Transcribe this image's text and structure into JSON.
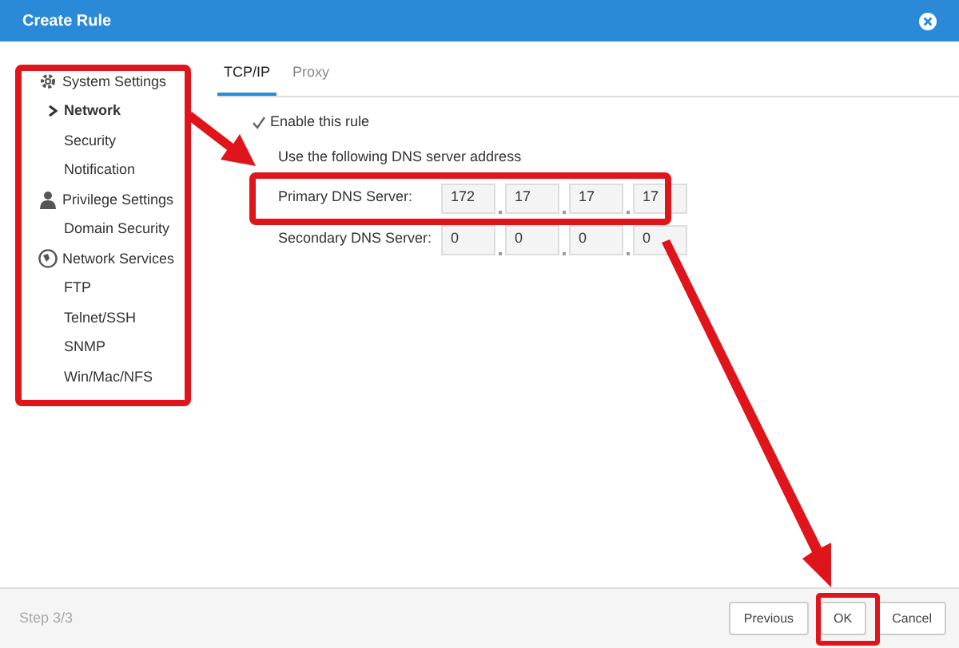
{
  "window": {
    "title": "Create Rule"
  },
  "sidebar": {
    "items": [
      {
        "label": "System Settings",
        "children": [
          {
            "label": "Network",
            "selected": true
          },
          {
            "label": "Security",
            "selected": false
          },
          {
            "label": "Notification",
            "selected": false
          }
        ]
      },
      {
        "label": "Privilege Settings",
        "children": [
          {
            "label": "Domain Security",
            "selected": false
          }
        ]
      },
      {
        "label": "Network Services",
        "children": [
          {
            "label": "FTP",
            "selected": false
          },
          {
            "label": "Telnet/SSH",
            "selected": false
          },
          {
            "label": "SNMP",
            "selected": false
          },
          {
            "label": "Win/Mac/NFS",
            "selected": false
          }
        ]
      }
    ]
  },
  "tabs": [
    {
      "label": "TCP/IP",
      "selected": true
    },
    {
      "label": "Proxy",
      "selected": false
    }
  ],
  "enable": {
    "label": "Enable this rule",
    "checked": true
  },
  "dns_heading": "Use the following DNS server address",
  "dns": [
    {
      "label": "Primary DNS Server:",
      "octets": [
        "172",
        "17",
        "17",
        "17"
      ]
    },
    {
      "label": "Secondary DNS Server:",
      "octets": [
        "0",
        "0",
        "0",
        "0"
      ]
    }
  ],
  "footer": {
    "step": "Step 3/3",
    "buttons": [
      "Previous",
      "OK",
      "Cancel"
    ]
  }
}
